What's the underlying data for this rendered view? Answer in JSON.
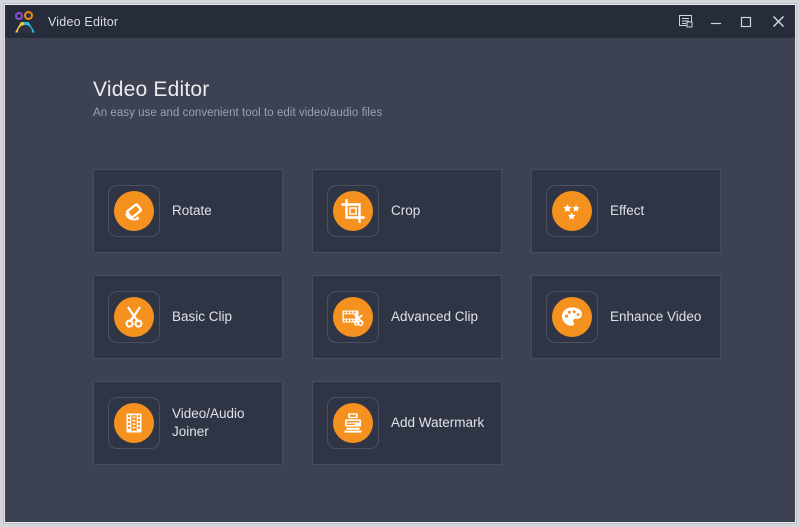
{
  "window": {
    "title": "Video Editor",
    "app_icon": "people-group-icon",
    "controls": [
      {
        "name": "feedback-icon",
        "label": "Feedback"
      },
      {
        "name": "minimize-icon",
        "label": "Minimize"
      },
      {
        "name": "maximize-icon",
        "label": "Maximize"
      },
      {
        "name": "close-icon",
        "label": "Close"
      }
    ]
  },
  "header": {
    "title": "Video Editor",
    "subtitle": "An easy use and convenient tool to edit video/audio files"
  },
  "tools": [
    {
      "label": "Rotate",
      "icon": "rotate-icon"
    },
    {
      "label": "Crop",
      "icon": "crop-icon"
    },
    {
      "label": "Effect",
      "icon": "stars-effect-icon"
    },
    {
      "label": "Basic Clip",
      "icon": "scissors-icon"
    },
    {
      "label": "Advanced Clip",
      "icon": "filmstrip-scissors-icon"
    },
    {
      "label": "Enhance Video",
      "icon": "palette-icon"
    },
    {
      "label": "Video/Audio\nJoiner",
      "icon": "filmstrip-icon"
    },
    {
      "label": "Add Watermark",
      "icon": "stamp-icon"
    }
  ],
  "colors": {
    "accent": "#f5911e",
    "window_bg": "#3c4252",
    "titlebar_bg": "#262c39",
    "card_bg": "#2f3545",
    "card_border": "#464d5e",
    "title_text": "#e9ebef",
    "subtitle_text": "#9aa2b2"
  }
}
